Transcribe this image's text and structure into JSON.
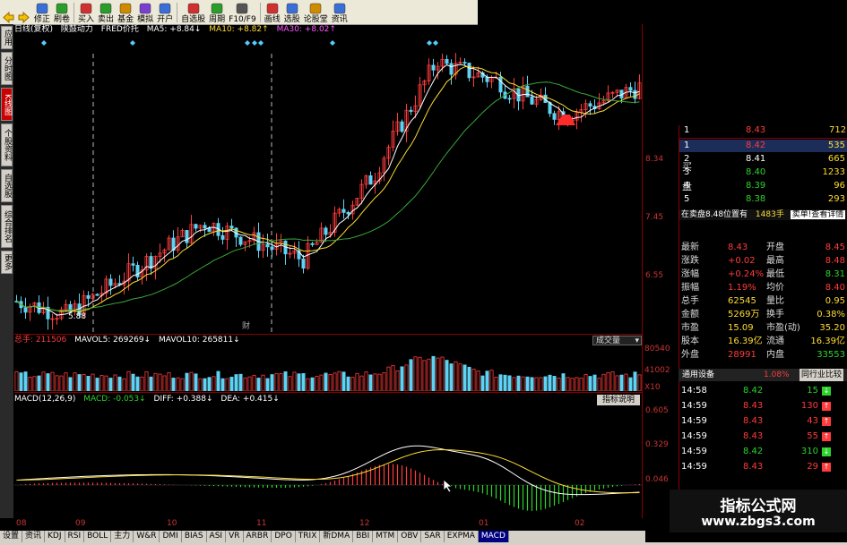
{
  "toolbar": {
    "items": [
      {
        "label": "修正",
        "icon": "edit-icon"
      },
      {
        "label": "刷卷",
        "icon": "refresh-icon"
      },
      {
        "label": "买入",
        "icon": "buy-icon"
      },
      {
        "label": "卖出",
        "icon": "sell-icon"
      },
      {
        "label": "基金",
        "icon": "fund-icon"
      },
      {
        "label": "模拟",
        "icon": "simulate-icon"
      },
      {
        "label": "开户",
        "icon": "account-icon"
      },
      {
        "label": "自选股",
        "icon": "favorites-icon"
      },
      {
        "label": "周期",
        "icon": "period-icon"
      },
      {
        "label": "F10/F9",
        "icon": "f10-icon"
      },
      {
        "label": "画线",
        "icon": "draw-line-icon"
      },
      {
        "label": "选股",
        "icon": "stock-picker-icon"
      },
      {
        "label": "论股堂",
        "icon": "forum-icon"
      },
      {
        "label": "资讯",
        "icon": "news-icon"
      }
    ]
  },
  "side_tabs": [
    "应用",
    "分时图",
    "K线图",
    "个股资料",
    "自选股",
    "综合排名",
    "更多"
  ],
  "side_active": 2,
  "kline_header": {
    "period": "日线(复权)",
    "name": "陕鼓动力",
    "indicator": "FRED价托",
    "ma5": "MA5: +8.84",
    "ma10": "MA10: +8.82",
    "ma30": "MA30: +8.02"
  },
  "price_axis": [
    "8.34",
    "7.45",
    "6.55"
  ],
  "low_label": "5.88",
  "event_label": "财",
  "volume_header": {
    "total": "总手: 211506",
    "mavol5": "MAVOL5: 269269",
    "mavol10": "MAVOL10: 265811",
    "dropdown": "成交量"
  },
  "volume_axis": [
    "80540",
    "41002",
    "X10"
  ],
  "macd_header": {
    "name": "MACD(12,26,9)",
    "macd": "MACD: -0.053",
    "diff": "DIFF: +0.388",
    "dea": "DEA: +0.415",
    "button": "指标说明"
  },
  "macd_axis": [
    "0.605",
    "0.329",
    "0.046"
  ],
  "x_axis": [
    "08",
    "09",
    "10",
    "11",
    "12",
    "01",
    "02"
  ],
  "bottom_tabs": [
    "设置",
    "资讯",
    "KDJ",
    "RSI",
    "BOLL",
    "主力",
    "W&R",
    "DMI",
    "BIAS",
    "ASI",
    "VR",
    "ARBR",
    "DPO",
    "TRIX",
    "新DMA",
    "BBI",
    "MTM",
    "OBV",
    "SAR",
    "EXPMA",
    "MACD"
  ],
  "bottom_active": 20,
  "order_book": {
    "sell_label": "卖盘",
    "buy_label": "买盘",
    "sell": [
      {
        "n": "1",
        "p": "8.43",
        "v": "712"
      }
    ],
    "buy": [
      {
        "n": "1",
        "p": "8.42",
        "v": "535"
      },
      {
        "n": "2",
        "p": "8.41",
        "v": "665"
      },
      {
        "n": "3",
        "p": "8.40",
        "v": "1233"
      },
      {
        "n": "4",
        "p": "8.39",
        "v": "96"
      },
      {
        "n": "5",
        "p": "8.38",
        "v": "293"
      }
    ],
    "notice": "在卖盘8.48位置有",
    "notice_vol": "1483手",
    "notice_tag": "卖单!查看详情"
  },
  "quote": [
    {
      "k1": "最新",
      "v1": "8.43",
      "c1": "red",
      "k2": "开盘",
      "v2": "8.45",
      "c2": "red"
    },
    {
      "k1": "涨跌",
      "v1": "+0.02",
      "c1": "red",
      "k2": "最高",
      "v2": "8.48",
      "c2": "red"
    },
    {
      "k1": "涨幅",
      "v1": "+0.24%",
      "c1": "red",
      "k2": "最低",
      "v2": "8.31",
      "c2": "grn"
    },
    {
      "k1": "振幅",
      "v1": "1.19%",
      "c1": "red",
      "k2": "均价",
      "v2": "8.40",
      "c2": "red"
    },
    {
      "k1": "总手",
      "v1": "62545",
      "c1": "yel",
      "k2": "量比",
      "v2": "0.95",
      "c2": "yel"
    },
    {
      "k1": "金额",
      "v1": "5269万",
      "c1": "yel",
      "k2": "换手",
      "v2": "0.38%",
      "c2": "yel"
    },
    {
      "k1": "市盈",
      "v1": "15.09",
      "c1": "yel",
      "k2": "市盈(动)",
      "v2": "35.20",
      "c2": "yel"
    },
    {
      "k1": "股本",
      "v1": "16.39亿",
      "c1": "yel",
      "k2": "流通",
      "v2": "16.39亿",
      "c2": "yel"
    },
    {
      "k1": "外盘",
      "v1": "28991",
      "c1": "red",
      "k2": "内盘",
      "v2": "33553",
      "c2": "grn"
    }
  ],
  "industry": {
    "name": "通用设备",
    "pct": "1.08%",
    "compare": "同行业比较"
  },
  "ticks": [
    {
      "t": "14:58",
      "p": "8.42",
      "v": "15",
      "d": "down"
    },
    {
      "t": "14:59",
      "p": "8.43",
      "v": "130",
      "d": "up"
    },
    {
      "t": "14:59",
      "p": "8.43",
      "v": "43",
      "d": "up"
    },
    {
      "t": "14:59",
      "p": "8.43",
      "v": "55",
      "d": "up"
    },
    {
      "t": "14:59",
      "p": "8.42",
      "v": "310",
      "d": "down"
    },
    {
      "t": "14:59",
      "p": "8.43",
      "v": "29",
      "d": "up"
    }
  ],
  "watermark": {
    "title": "指标公式网",
    "url": "www.zbgs3.com"
  },
  "colors": {
    "up": "#ff3b3b",
    "down": "#2bd42b",
    "panel_border": "#8b0000",
    "candle_down": "#5fd3f3"
  }
}
